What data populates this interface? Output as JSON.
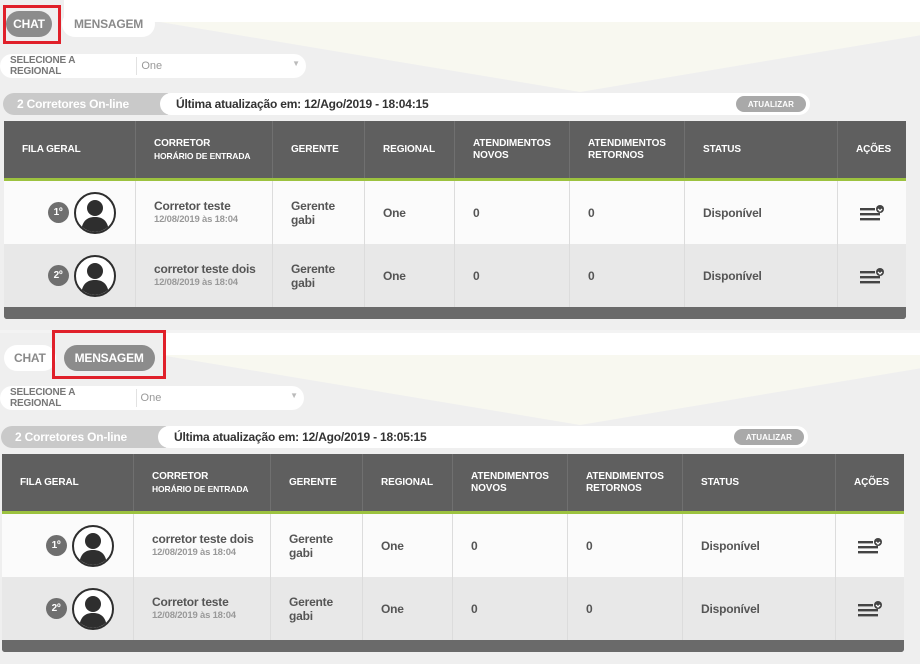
{
  "panels": [
    {
      "tabs": [
        {
          "label": "CHAT"
        },
        {
          "label": "MENSAGEM"
        }
      ],
      "active_tab": "CHAT",
      "regional": {
        "label": "SELECIONE A REGIONAL",
        "selected": "One"
      },
      "online_count": "2 Corretores On-line",
      "last_update": "Última atualização em: 12/Ago/2019 - 18:04:15",
      "refresh_label": "ATUALIZAR",
      "headers": {
        "fila": "FILA GERAL",
        "corretor": "CORRETOR",
        "horario": "HORÁRIO DE ENTRADA",
        "gerente": "GERENTE",
        "regional": "REGIONAL",
        "novos_1": "ATENDIMENTOS",
        "novos_2": "NOVOS",
        "retornos_1": "ATENDIMENTOS",
        "retornos_2": "RETORNOS",
        "status": "STATUS",
        "acoes": "AÇÕES"
      },
      "rows": [
        {
          "rank": "1º",
          "name": "Corretor teste",
          "time": "12/08/2019 às 18:04",
          "gerente_1": "Gerente",
          "gerente_2": "gabi",
          "regional": "One",
          "novos": "0",
          "retornos": "0",
          "status": "Disponível"
        },
        {
          "rank": "2º",
          "name": "corretor teste dois",
          "time": "12/08/2019 às 18:04",
          "gerente_1": "Gerente",
          "gerente_2": "gabi",
          "regional": "One",
          "novos": "0",
          "retornos": "0",
          "status": "Disponível"
        }
      ]
    },
    {
      "tabs": [
        {
          "label": "CHAT"
        },
        {
          "label": "MENSAGEM"
        }
      ],
      "active_tab": "MENSAGEM",
      "regional": {
        "label": "SELECIONE A REGIONAL",
        "selected": "One"
      },
      "online_count": "2 Corretores On-line",
      "last_update": "Última atualização em: 12/Ago/2019 - 18:05:15",
      "refresh_label": "ATUALIZAR",
      "headers": {
        "fila": "FILA GERAL",
        "corretor": "CORRETOR",
        "horario": "HORÁRIO DE ENTRADA",
        "gerente": "GERENTE",
        "regional": "REGIONAL",
        "novos_1": "ATENDIMENTOS",
        "novos_2": "NOVOS",
        "retornos_1": "ATENDIMENTOS",
        "retornos_2": "RETORNOS",
        "status": "STATUS",
        "acoes": "AÇÕES"
      },
      "rows": [
        {
          "rank": "1º",
          "name": "corretor teste dois",
          "time": "12/08/2019 às 18:04",
          "gerente_1": "Gerente",
          "gerente_2": "gabi",
          "regional": "One",
          "novos": "0",
          "retornos": "0",
          "status": "Disponível"
        },
        {
          "rank": "2º",
          "name": "Corretor teste",
          "time": "12/08/2019 às 18:04",
          "gerente_1": "Gerente",
          "gerente_2": "gabi",
          "regional": "One",
          "novos": "0",
          "retornos": "0",
          "status": "Disponível"
        }
      ]
    }
  ],
  "colors": {
    "highlight": "#e0202a",
    "accent_green": "#9cc23f",
    "header_gray": "#5f5f5f",
    "tab_active": "#8c8c8c"
  },
  "icons": {
    "avatar": "user-silhouette-icon",
    "acoes": "list-options-icon"
  }
}
